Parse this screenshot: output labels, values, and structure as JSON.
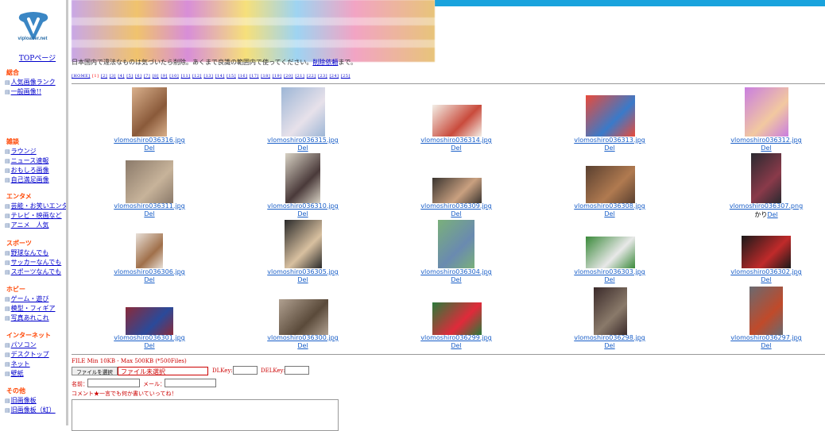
{
  "sidebar": {
    "logo_text": "viploader.net",
    "top_link": "TOPページ",
    "categories": [
      {
        "title": "総合",
        "items": [
          "人気画像ランク",
          "一般画像!!"
        ]
      },
      {
        "title": "雑談",
        "items": [
          "ラウンジ",
          "ニュース速報",
          "おもしろ画像",
          "自己満足画像"
        ]
      },
      {
        "title": "エンタメ",
        "items": [
          "芸能・お笑いエンタ",
          "テレビ・映画など",
          "アニメ　人気"
        ]
      },
      {
        "title": "スポーツ",
        "items": [
          "野球なんでも",
          "サッカーなんでも",
          "スポーツなんでも"
        ]
      },
      {
        "title": "ホビー",
        "items": [
          "ゲーム・遊び",
          "模型・フィギア",
          "写真あれこれ"
        ]
      },
      {
        "title": "インターネット",
        "items": [
          "パソコン",
          "デスクトップ",
          "ネット",
          "壁紙"
        ]
      },
      {
        "title": "その他",
        "items": [
          "旧画像板",
          "旧画像板（虹）"
        ]
      }
    ]
  },
  "notice": {
    "text": "日本国内で違法なものは気づいたら削除。あくまで良識の範囲内で使ってください。",
    "link": "削除依頼",
    "suffix": "まで。"
  },
  "pagination": {
    "home": "[HOME]",
    "current": "[1]",
    "pages": [
      "[2]",
      "[3]",
      "[4]",
      "[5]",
      "[6]",
      "[7]",
      "[8]",
      "[9]",
      "[10]",
      "[11]",
      "[12]",
      "[13]",
      "[14]",
      "[15]",
      "[16]",
      "[17]",
      "[18]",
      "[19]",
      "[20]",
      "[21]",
      "[22]",
      "[23]",
      "[24]",
      "[25]"
    ]
  },
  "images": [
    {
      "file": "vlomoshiro036316.jpg",
      "del": "Del",
      "note": ""
    },
    {
      "file": "vlomoshiro036315.jpg",
      "del": "Del",
      "note": ""
    },
    {
      "file": "vlomoshiro036314.jpg",
      "del": "Del",
      "note": ""
    },
    {
      "file": "vlomoshiro036313.jpg",
      "del": "Del",
      "note": ""
    },
    {
      "file": "vlomoshiro036312.jpg",
      "del": "Del",
      "note": ""
    },
    {
      "file": "vlomoshiro036311.jpg",
      "del": "Del",
      "note": ""
    },
    {
      "file": "vlomoshiro036310.jpg",
      "del": "Del",
      "note": ""
    },
    {
      "file": "vlomoshiro036309.jpg",
      "del": "Del",
      "note": ""
    },
    {
      "file": "vlomoshiro036308.jpg",
      "del": "Del",
      "note": ""
    },
    {
      "file": "vlomoshiro036307.png",
      "del": "Del",
      "note": "かり"
    },
    {
      "file": "vlomoshiro036306.jpg",
      "del": "Del",
      "note": ""
    },
    {
      "file": "vlomoshiro036305.jpg",
      "del": "Del",
      "note": ""
    },
    {
      "file": "vlomoshiro036304.jpg",
      "del": "Del",
      "note": ""
    },
    {
      "file": "vlomoshiro036303.jpg",
      "del": "Del",
      "note": ""
    },
    {
      "file": "vlomoshiro036302.jpg",
      "del": "Del",
      "note": ""
    },
    {
      "file": "vlomoshiro036301.jpg",
      "del": "Del",
      "note": ""
    },
    {
      "file": "vlomoshiro036300.jpg",
      "del": "Del",
      "note": ""
    },
    {
      "file": "vlomoshiro036299.jpg",
      "del": "Del",
      "note": ""
    },
    {
      "file": "vlomoshiro036298.jpg",
      "del": "Del",
      "note": ""
    },
    {
      "file": "vlomoshiro036297.jpg",
      "del": "Del",
      "note": ""
    }
  ],
  "upload": {
    "file_info": "FILE Min 10KB - Max 500KB (*500Files)",
    "file_button": "ファイルを選択",
    "file_status": "ファイル未選択",
    "dlkey_label": "DLKey:",
    "delkey_label": "DELKey:",
    "name_label": "名前：",
    "mail_label": "メール：",
    "comment_label": "コメント★一言でも何か書いていってね！"
  },
  "colors": {
    "accent": "#1aa3dd",
    "link": "#0000cc",
    "category": "#ff4400",
    "warning": "#cc0000"
  }
}
